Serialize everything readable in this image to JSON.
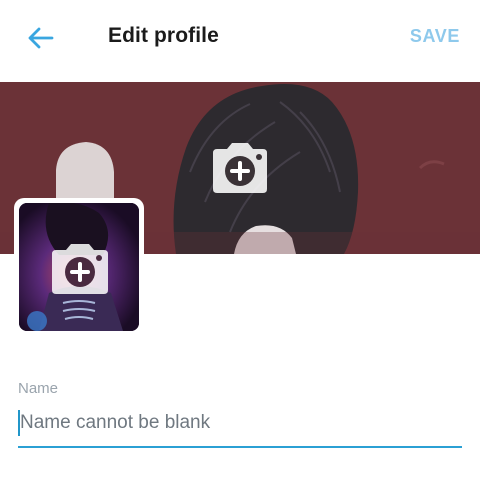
{
  "header": {
    "title": "Edit profile",
    "save_label": "SAVE",
    "back_icon": "arrow-left-icon"
  },
  "banner": {
    "icon": "camera-plus-icon"
  },
  "avatar": {
    "icon": "camera-plus-icon"
  },
  "form": {
    "name_label": "Name",
    "name_value": "",
    "name_placeholder": "Name cannot be blank"
  },
  "colors": {
    "accent": "#2ba0d4",
    "save_disabled": "#8ec9ec",
    "banner_bg": "#6b3237"
  }
}
